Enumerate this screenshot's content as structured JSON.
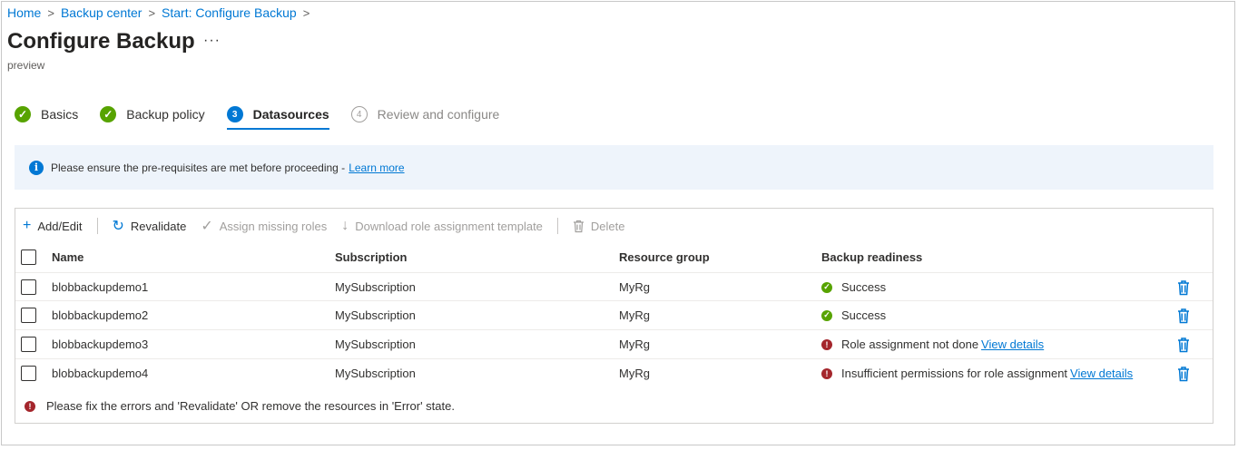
{
  "breadcrumb": [
    "Home",
    "Backup center",
    "Start: Configure Backup"
  ],
  "page": {
    "title": "Configure Backup",
    "more": "···",
    "subtitle": "preview"
  },
  "steps": [
    {
      "label": "Basics",
      "marker": "✓",
      "state": "done"
    },
    {
      "label": "Backup policy",
      "marker": "✓",
      "state": "done"
    },
    {
      "label": "Datasources",
      "marker": "3",
      "state": "active"
    },
    {
      "label": "Review and configure",
      "marker": "4",
      "state": "pending"
    }
  ],
  "info": {
    "text": "Please ensure the pre-requisites are met before proceeding -",
    "link": "Learn more",
    "icon": "info-icon"
  },
  "toolbar": {
    "add": "Add/Edit",
    "revalidate": "Revalidate",
    "assign": "Assign missing roles",
    "download": "Download role assignment template",
    "delete": "Delete"
  },
  "table": {
    "headers": [
      "Name",
      "Subscription",
      "Resource group",
      "Backup readiness"
    ],
    "rows": [
      {
        "name": "blobbackupdemo1",
        "subscription": "MySubscription",
        "rg": "MyRg",
        "status": "Success",
        "state": "ok",
        "link": ""
      },
      {
        "name": "blobbackupdemo2",
        "subscription": "MySubscription",
        "rg": "MyRg",
        "status": "Success",
        "state": "ok",
        "link": ""
      },
      {
        "name": "blobbackupdemo3",
        "subscription": "MySubscription",
        "rg": "MyRg",
        "status": "Role assignment not done",
        "state": "err",
        "link": "View details"
      },
      {
        "name": "blobbackupdemo4",
        "subscription": "MySubscription",
        "rg": "MyRg",
        "status": "Insufficient permissions for role assignment",
        "state": "err",
        "link": "View details"
      }
    ]
  },
  "footer": {
    "text": "Please fix the errors and 'Revalidate' OR remove the resources in 'Error' state."
  },
  "colors": {
    "accent": "#0078d4",
    "success": "#57a300",
    "error": "#a4262c",
    "info_bg": "#eef4fb"
  }
}
